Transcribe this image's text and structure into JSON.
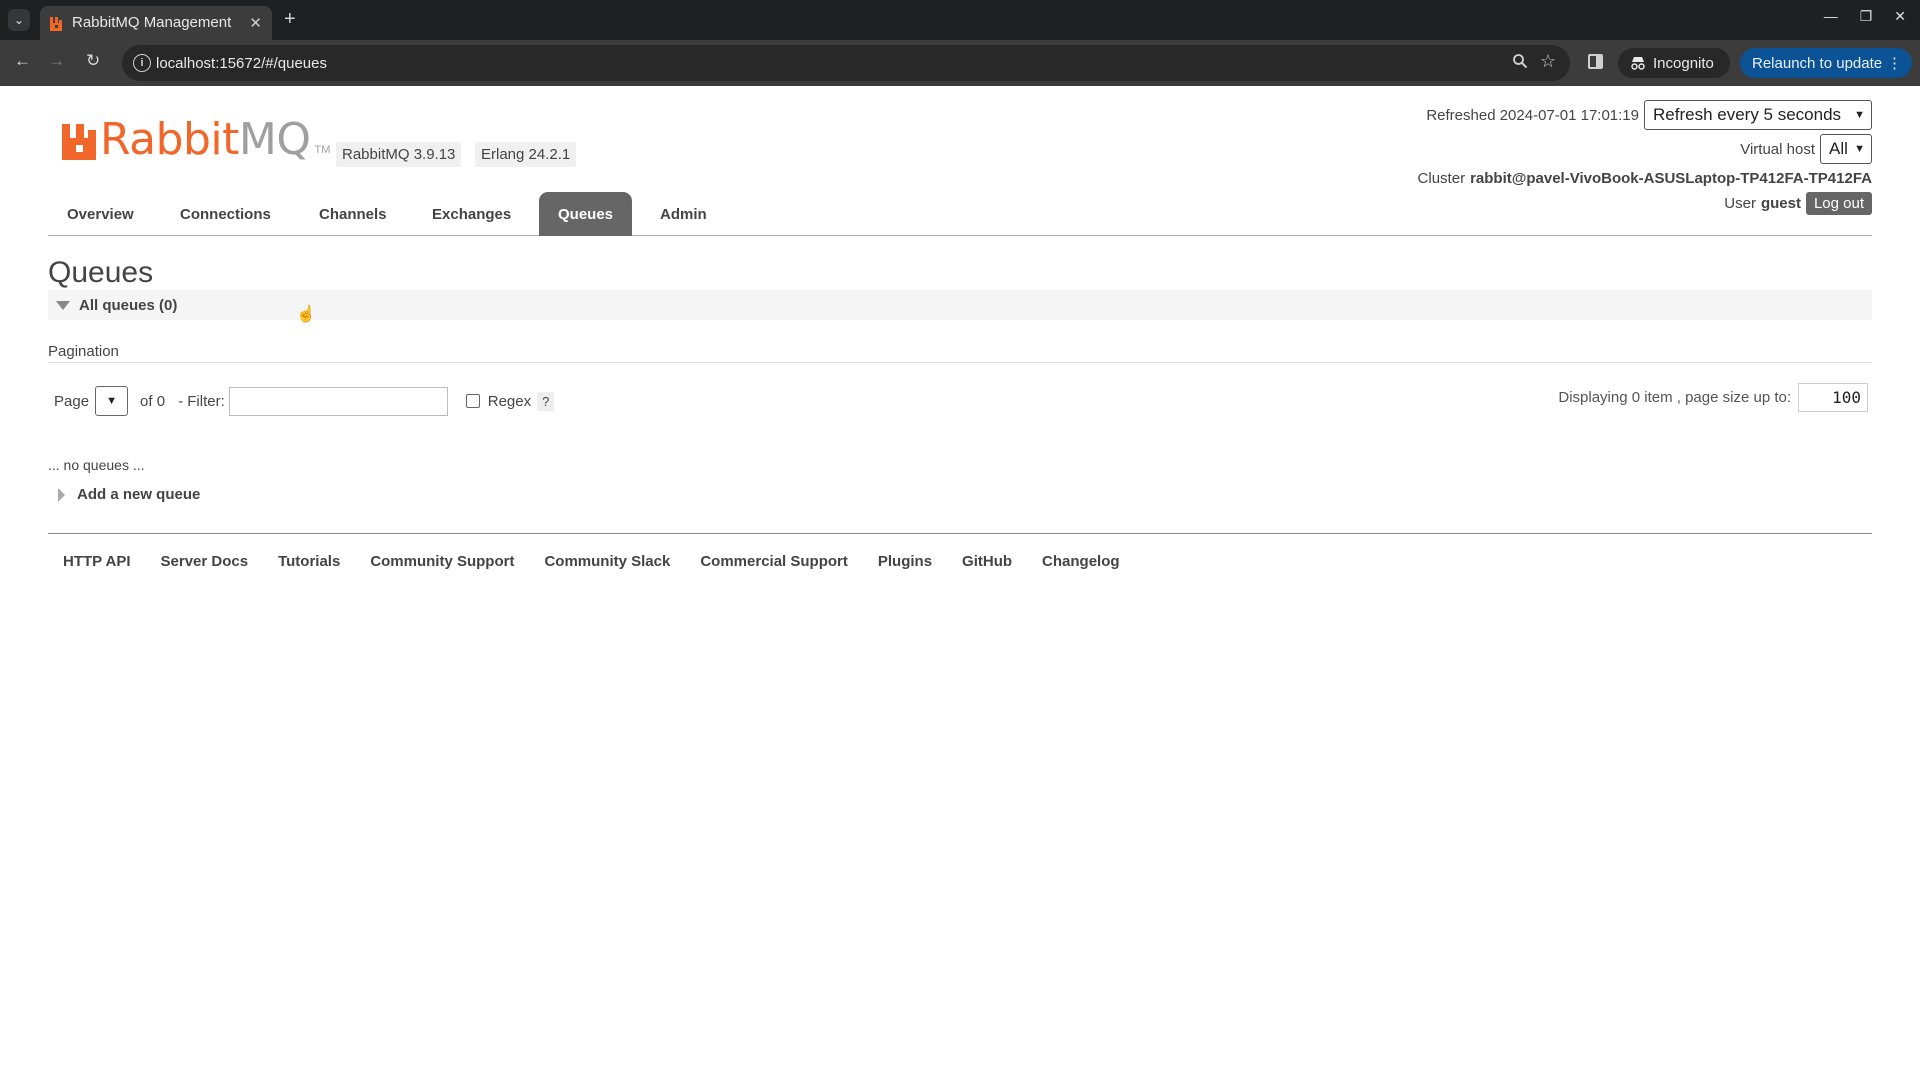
{
  "browser": {
    "tab_title": "RabbitMQ Management",
    "url": "localhost:15672/#/queues",
    "incognito_label": "Incognito",
    "relaunch_label": "Relaunch to update",
    "accent_color": "#0b5394"
  },
  "header": {
    "logo_rabbit": "Rabbit",
    "logo_mq": "MQ",
    "logo_tm": "TM",
    "version_badge": "RabbitMQ 3.9.13",
    "erlang_badge": "Erlang 24.2.1",
    "refreshed_label": "Refreshed 2024-07-01 17:01:19",
    "refresh_select_value": "Refresh every 5 seconds",
    "virtual_host_label": "Virtual host",
    "virtual_host_value": "All",
    "cluster_label": "Cluster",
    "cluster_value": "rabbit@pavel-VivoBook-ASUSLaptop-TP412FA-TP412FA",
    "user_label": "User",
    "user_value": "guest",
    "logout_label": "Log out",
    "brand_color": "#f06729"
  },
  "nav": {
    "items": [
      "Overview",
      "Connections",
      "Channels",
      "Exchanges",
      "Queues",
      "Admin"
    ],
    "active": "Queues"
  },
  "main": {
    "title": "Queues",
    "section_label": "All queues (0)",
    "pagination_label": "Pagination",
    "page_label": "Page",
    "of_label": "of 0",
    "filter_label": "- Filter:",
    "filter_value": "",
    "regex_label": "Regex",
    "help_label": "?",
    "display_info": "Displaying 0 item , page size up to:",
    "page_size": "100",
    "empty_message": "... no queues ...",
    "add_queue_label": "Add a new queue"
  },
  "footer": {
    "links": [
      "HTTP API",
      "Server Docs",
      "Tutorials",
      "Community Support",
      "Community Slack",
      "Commercial Support",
      "Plugins",
      "GitHub",
      "Changelog"
    ]
  }
}
